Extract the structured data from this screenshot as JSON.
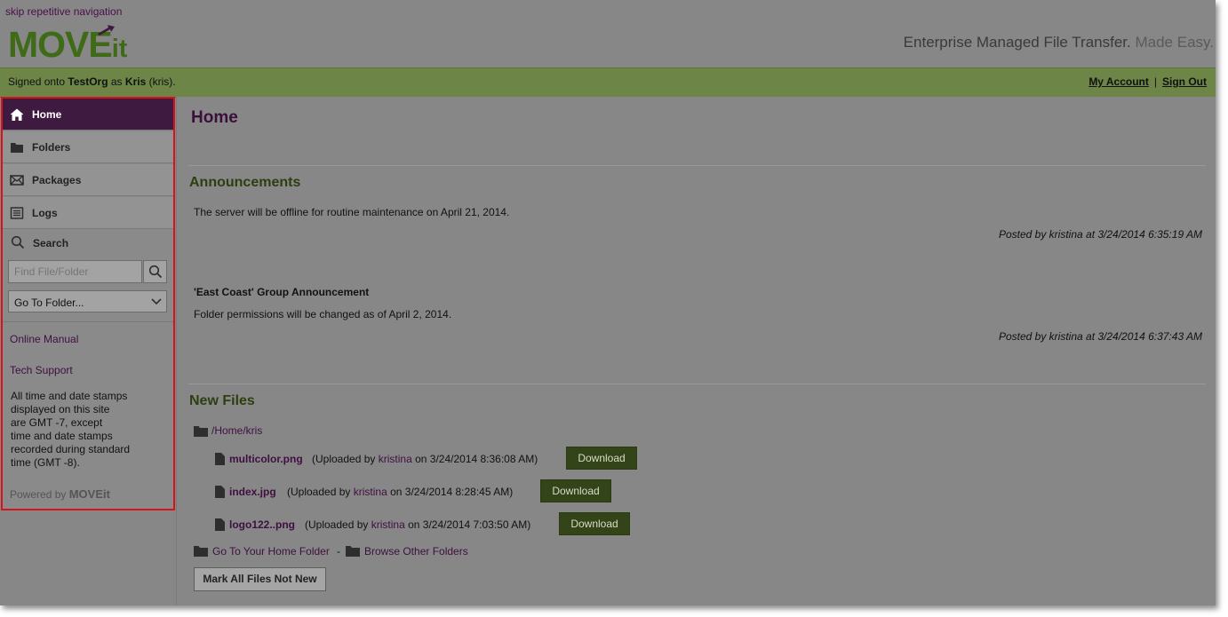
{
  "header": {
    "skip_link": "skip repetitive navigation",
    "logo_text": "MOVE",
    "logo_suffix": "it",
    "tagline_main": "Enterprise Managed File Transfer.",
    "tagline_sub": "Made Easy."
  },
  "topbar": {
    "signed_prefix": "Signed onto",
    "org": "TestOrg",
    "as": "as",
    "user": "Kris",
    "username": "(kris).",
    "my_account": "My Account",
    "sep": "|",
    "sign_out": "Sign Out"
  },
  "sidebar": {
    "items": [
      {
        "label": "Home",
        "icon": "home-icon",
        "active": true
      },
      {
        "label": "Folders",
        "icon": "folder-icon",
        "active": false
      },
      {
        "label": "Packages",
        "icon": "envelope-icon",
        "active": false
      },
      {
        "label": "Logs",
        "icon": "log-icon",
        "active": false
      }
    ],
    "search_label": "Search",
    "search_placeholder": "Find File/Folder",
    "goto_label": "Go To Folder...",
    "online_manual": "Online Manual",
    "tech_support": "Tech Support",
    "note_lines": [
      "All time and date stamps",
      "displayed on this site",
      "are GMT -7, except",
      "time and date stamps",
      "recorded during standard",
      "time (GMT -8)."
    ],
    "powered_by": "Powered by",
    "powered_logo": "MOVEit"
  },
  "main": {
    "title": "Home",
    "announcements": {
      "title": "Announcements",
      "items": [
        {
          "heading": "",
          "text": "The server will be offline for routine maintenance on April 21, 2014.",
          "posted": "Posted by kristina at 3/24/2014 6:35:19 AM"
        },
        {
          "heading": "'East Coast' Group Announcement",
          "text": "Folder permissions will be changed as of April 2, 2014.",
          "posted": "Posted by kristina at 3/24/2014 6:37:43 AM"
        }
      ]
    },
    "new_files": {
      "title": "New Files",
      "folder": "/Home/kris",
      "files": [
        {
          "name": "multicolor.png",
          "pre": "(Uploaded by",
          "by": "kristina",
          "post": "on 3/24/2014 8:36:08 AM)",
          "button": "Download"
        },
        {
          "name": "index.jpg",
          "pre": "(Uploaded by",
          "by": "kristina",
          "post": "on 3/24/2014 8:28:45 AM)",
          "button": "Download"
        },
        {
          "name": "logo122..png",
          "pre": "(Uploaded by",
          "by": "kristina",
          "post": "on 3/24/2014 7:03:50 AM)",
          "button": "Download"
        }
      ],
      "home_folder_link": "Go To Your Home Folder",
      "dash": "-",
      "browse_link": "Browse Other Folders",
      "mark_button": "Mark All Files Not New"
    }
  },
  "colors": {
    "accent_purple": "#3f1a40",
    "accent_green": "#6d8546",
    "highlight_border": "#d8121a"
  }
}
